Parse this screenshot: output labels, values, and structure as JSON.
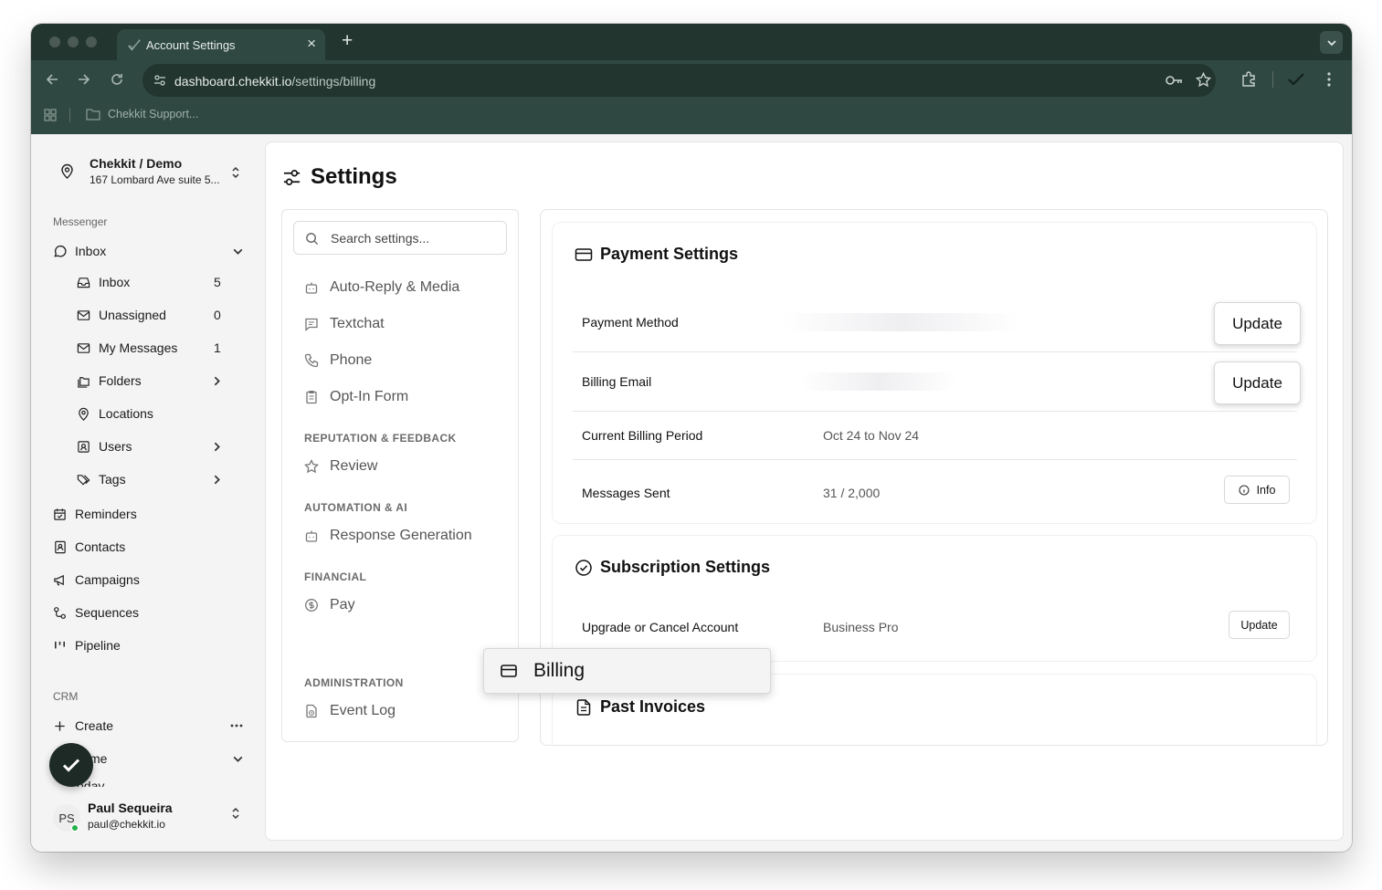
{
  "browser": {
    "tab_title": "Account Settings",
    "url_domain": "dashboard.chekkit.io",
    "url_path": "/settings/billing",
    "bookmark": "Chekkit Support..."
  },
  "sidebar": {
    "location_name": "Chekkit / Demo",
    "location_address": "167 Lombard Ave suite 5...",
    "messenger_label": "Messenger",
    "inbox_group": "Inbox",
    "inbox_items": [
      {
        "label": "Inbox",
        "count": "5"
      },
      {
        "label": "Unassigned",
        "count": "0"
      },
      {
        "label": "My Messages",
        "count": "1"
      },
      {
        "label": "Folders"
      },
      {
        "label": "Locations"
      },
      {
        "label": "Users"
      },
      {
        "label": "Tags"
      }
    ],
    "main_items": [
      "Reminders",
      "Contacts",
      "Campaigns",
      "Sequences",
      "Pipeline"
    ],
    "crm_label": "CRM",
    "create": "Create",
    "home_partial": "me",
    "below_partial": "oday",
    "user_initials": "PS",
    "user_name": "Paul Sequeira",
    "user_email": "paul@chekkit.io"
  },
  "settings": {
    "title": "Settings",
    "search_placeholder": "Search settings...",
    "nav": {
      "auto_reply": "Auto-Reply & Media",
      "textchat": "Textchat",
      "phone": "Phone",
      "optin": "Opt-In Form",
      "cat_reputation": "REPUTATION & FEEDBACK",
      "review": "Review",
      "cat_automation": "AUTOMATION & AI",
      "response": "Response Generation",
      "cat_financial": "FINANCIAL",
      "pay": "Pay",
      "billing": "Billing",
      "cat_admin": "ADMINISTRATION",
      "event_log": "Event Log"
    }
  },
  "payment": {
    "title": "Payment Settings",
    "method_label": "Payment Method",
    "email_label": "Billing Email",
    "update": "Update",
    "period_label": "Current Billing Period",
    "period_value": "Oct 24 to Nov 24",
    "sent_label": "Messages Sent",
    "sent_value": "31 / 2,000",
    "info": "Info"
  },
  "subscription": {
    "title": "Subscription Settings",
    "label": "Upgrade or Cancel Account",
    "value": "Business Pro",
    "update": "Update"
  },
  "invoices": {
    "title": "Past Invoices"
  },
  "colors": {
    "browser_frame": "#22352f",
    "browser_toolbar": "#2f4842",
    "app_bg": "#f4f4f5",
    "fab": "#1d2a26",
    "online": "#22b14c"
  }
}
